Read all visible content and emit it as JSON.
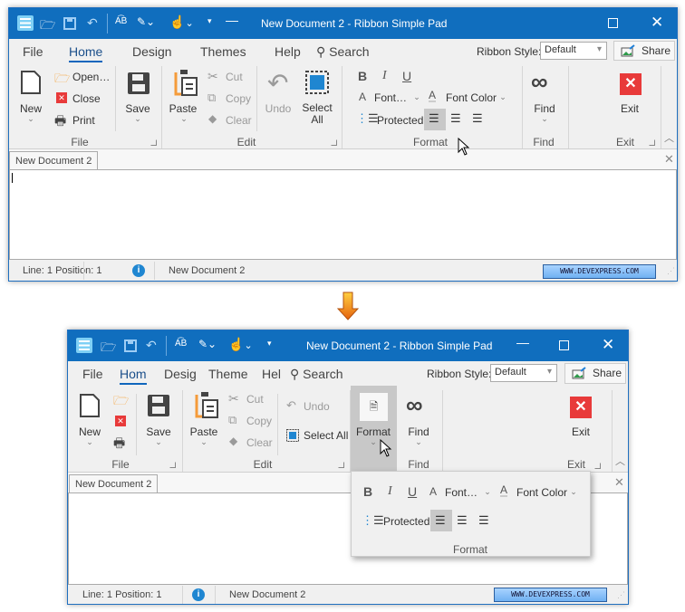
{
  "title": "New Document 2 - Ribbon Simple Pad",
  "tabs": [
    "File",
    "Home",
    "Design",
    "Themes",
    "Help"
  ],
  "tabs_compact": [
    "File",
    "Hom",
    "Desig",
    "Theme",
    "Hel"
  ],
  "search": "Search",
  "ribbon_style_label": "Ribbon Style:",
  "ribbon_style_value": "Default",
  "share": "Share",
  "file": {
    "new": "New",
    "open": "Open…",
    "close": "Close",
    "print": "Print",
    "save": "Save",
    "group": "File"
  },
  "edit": {
    "paste": "Paste",
    "cut": "Cut",
    "copy": "Copy",
    "clear": "Clear",
    "undo": "Undo",
    "select_all": "Select All",
    "group": "Edit"
  },
  "format": {
    "bold": "B",
    "italic": "I",
    "underline": "U",
    "font": "Font…",
    "font_color": "Font Color",
    "protected": "Protected",
    "group": "Format",
    "collapsed_button": "Format"
  },
  "find": {
    "find": "Find",
    "group": "Find"
  },
  "exit": {
    "exit": "Exit",
    "group": "Exit"
  },
  "doc_tab": "New Document 2",
  "status": {
    "position": "Line: 1  Position: 1",
    "doc": "New Document 2",
    "link": "WWW.DEVEXPRESS.COM"
  },
  "colors": {
    "titlebar": "#106ebe",
    "exit_red": "#e83a3a",
    "accent_orange": "#f59b3a"
  }
}
